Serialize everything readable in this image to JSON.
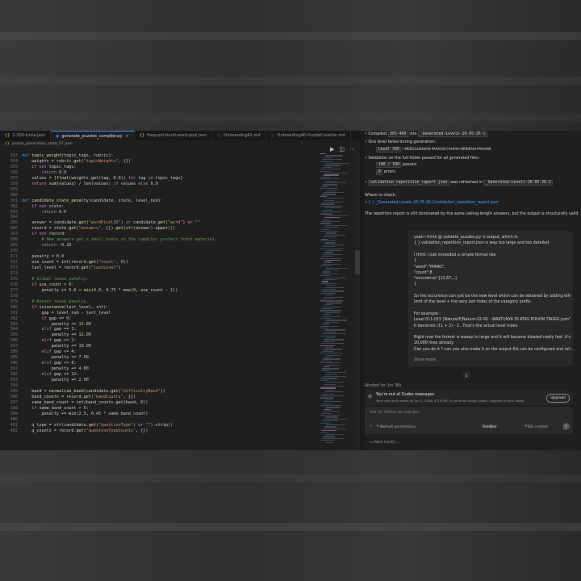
{
  "tabs": [
    {
      "label": "1-300-trivia.json",
      "icon": "json-icon"
    },
    {
      "label": "generate_puzzles_compiler.py",
      "icon": "python-icon",
      "active": true
    },
    {
      "label": "frequent-band-word-pool.json",
      "icon": "json-icon"
    },
    {
      "label": "Onboarding41.md",
      "icon": "markdown-icon"
    },
    {
      "label": "Onboarding40-PuzzleCreation.md",
      "icon": "markdown-icon"
    }
  ],
  "breadcrumb": "puzzle_generation_state_07.json",
  "code_lines": [
    {
      "n": "353",
      "t": "def topic_weight(topic_tags, rubric):"
    },
    {
      "n": "354",
      "t": "    weights = rubric.get(\"topicWeights\", {})"
    },
    {
      "n": "355",
      "t": "    if not topic_tags:"
    },
    {
      "n": "356",
      "t": "        return 0.0"
    },
    {
      "n": "357",
      "t": "    values = [float(weights.get(tag, 0.0)) for tag in topic_tags]"
    },
    {
      "n": "358",
      "t": "    return sum(values) / len(values) if values else 0.0"
    },
    {
      "n": "359",
      "t": ""
    },
    {
      "n": "360",
      "t": ""
    },
    {
      "n": "361",
      "t": "def candidate_state_penalty(candidate, state, level_num):"
    },
    {
      "n": "362",
      "t": "    if not state:"
    },
    {
      "n": "363",
      "t": "        return 0.0"
    },
    {
      "n": "364",
      "t": ""
    },
    {
      "n": "365",
      "t": "    answer = candidate.get(\"wordPixelID\") or candidate.get(\"word\") or \"\""
    },
    {
      "n": "366",
      "t": "    record = state.get(\"answers\", {}).get(str(answer).upper())"
    },
    {
      "n": "367",
      "t": "    if not record:"
    },
    {
      "n": "368",
      "t": "        # New answers get a small bonus so the compiler prefers fresh material."
    },
    {
      "n": "369",
      "t": "        return -0.20"
    },
    {
      "n": "370",
      "t": ""
    },
    {
      "n": "371",
      "t": "    penalty = 0.0"
    },
    {
      "n": "372",
      "t": "    use_count = int(record.get(\"count\", 0))"
    },
    {
      "n": "373",
      "t": "    last_level = record.get(\"lastLevel\")"
    },
    {
      "n": "374",
      "t": ""
    },
    {
      "n": "375",
      "t": "    # Global reuse penalty."
    },
    {
      "n": "376",
      "t": "    if use_count > 0:"
    },
    {
      "n": "377",
      "t": "        penalty += 0.6 + min(4.0, 0.75 * max(0, use_count - 1))"
    },
    {
      "n": "378",
      "t": ""
    },
    {
      "n": "379",
      "t": "    # Recent reuse penalty."
    },
    {
      "n": "380",
      "t": "    if isinstance(last_level, int):"
    },
    {
      "n": "381",
      "t": "        gap = level_num - last_level"
    },
    {
      "n": "382",
      "t": "        if gap <= 0:"
    },
    {
      "n": "383",
      "t": "            penalty += 15.00"
    },
    {
      "n": "384",
      "t": "        elif gap == 1:"
    },
    {
      "n": "385",
      "t": "            penalty += 12.00"
    },
    {
      "n": "386",
      "t": "        elif gap <= 2:"
    },
    {
      "n": "387",
      "t": "            penalty += 10.00"
    },
    {
      "n": "388",
      "t": "        elif gap <= 4:"
    },
    {
      "n": "389",
      "t": "            penalty += 7.00"
    },
    {
      "n": "390",
      "t": "        elif gap <= 8:"
    },
    {
      "n": "391",
      "t": "            penalty += 4.00"
    },
    {
      "n": "392",
      "t": "        elif gap <= 12:"
    },
    {
      "n": "393",
      "t": "            penalty += 2.00"
    },
    {
      "n": "394",
      "t": ""
    },
    {
      "n": "395",
      "t": "    band = normalize_band(candidate.get(\"difficultyBand\"))"
    },
    {
      "n": "396",
      "t": "    band_counts = record.get(\"bandCounts\", {})"
    },
    {
      "n": "397",
      "t": "    same_band_count = int(band_counts.get(band, 0))"
    },
    {
      "n": "398",
      "t": "    if same_band_count > 0:"
    },
    {
      "n": "399",
      "t": "        penalty += min(2.5, 0.45 * same_band_count)"
    },
    {
      "n": "400",
      "t": ""
    },
    {
      "n": "401",
      "t": "    q_type = str(candidate.get(\"questionType\") or \"\").strip()"
    },
    {
      "n": "402",
      "t": "    q_counts = record.get(\"questionTypeCounts\", {})"
    }
  ],
  "chat": {
    "compiled_line": {
      "pre": "Compiled",
      "chip1": "301-400",
      "mid": "into",
      "chip2": "_Generated-Levels-26-05-26-1"
    },
    "failed_heading": "One level failed during generation:",
    "failed_item": {
      "chip": "Level 336",
      "rest": "/ MENGGUNAKAN PAKAIAN CAHAYA MENIKAHI PAKAIAN"
    },
    "validation_heading": "Validation on the full folder passed for all generated files:",
    "passed_item": {
      "chip": "100 / 100",
      "rest": "passed"
    },
    "errors_item": {
      "chip": "0",
      "rest": "errors"
    },
    "refreshed_item": {
      "chip1": "validation_repetition_report.json",
      "mid": "was refreshed in",
      "chip2": "_Generated-Levels-26-05-26-1"
    },
    "where_label": "Where to check:",
    "where_link": "{ } _Generated-Levels-26-05-26-1/validation_repetition_report.json",
    "summary": "The repetition report is still dominated by the same ceiling-length answers, but the output is structurally valid.",
    "user_msg": [
      "yeah i think  @ validate_puzzles.py 's output, which ie",
      "{ } validation_repetition_report.json is way too large and too detailed.",
      "",
      "I think i just mneeded a simple format like",
      "{",
      "\"word\":\"PIANO\",",
      "\"count\":8",
      "\"occurence\":[12,67,..]",
      "}",
      "",
      "So the occurence can just be the new level which can be obtained by adding left-",
      "limit of the level + the very last index of the category prefix.",
      "",
      "For example :",
      "Level 011-015 [Nature/F/Nature-02-02 - WAKTUNYA DI ATAS POHON TINGGI.json\"",
      "It becomes (11 + 2) - 1 . That's the actual level index",
      "",
      "Right now the format is waaay to large and it will become bloated really fast. It's",
      "20,000 lines already.",
      "Can you do it ? can you also make it so the output file can be configured and roll ..."
    ],
    "show_more": "Show more",
    "worked": "Worked for 1m 38s",
    "warn_title": "You're out of Codex messages",
    "warn_detail": "Your rate limit resets on Jun 1, 2026, 6:19 PM. To continue using Codex, upgrade to Plus today.",
    "upgrade": "Upgrade",
    "placeholder": "Ask for follow-up changes",
    "permissions": "Default permissions",
    "model": "5.4-Mini",
    "effort": "Medium",
    "ide": "IDE context",
    "work_mode": "Work locally"
  },
  "colors": {
    "accent": "#3794ff",
    "link": "#4da3ff",
    "keyword": "#c586c0",
    "string": "#ce9178",
    "number": "#b5cea8",
    "comment": "#6a9955"
  }
}
